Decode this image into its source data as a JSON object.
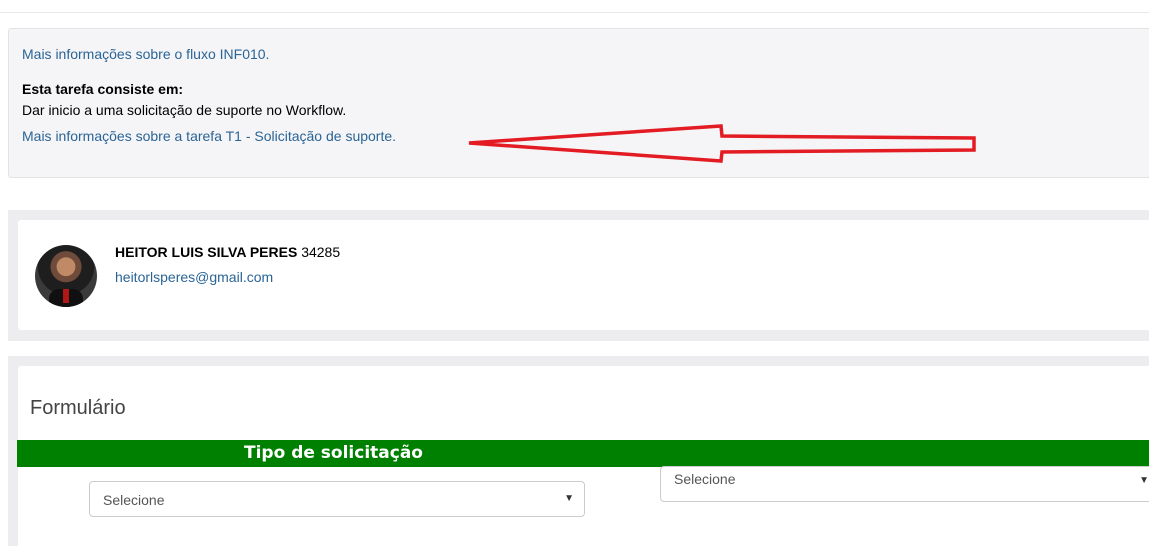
{
  "info": {
    "flow_link": "Mais informações sobre o fluxo INF010.",
    "heading": "Esta tarefa consiste em:",
    "description": "Dar inicio a uma solicitação de suporte no Workflow.",
    "task_link": "Mais informações sobre a tarefa T1 - Solicitação de suporte."
  },
  "user": {
    "name": "HEITOR LUIS SILVA PERES",
    "id": "34285",
    "email": "heitorlsperes@gmail.com"
  },
  "form": {
    "title": "Formulário",
    "section_header": "Tipo de solicitação",
    "select_left": "Selecione",
    "select_right": "Selecione"
  },
  "colors": {
    "link": "#2a6496",
    "section_header_bg": "#008000",
    "arrow": "#e31b23"
  },
  "icons": {
    "annotation": "red-arrow-icon",
    "dropdown": "caret-down-icon"
  }
}
